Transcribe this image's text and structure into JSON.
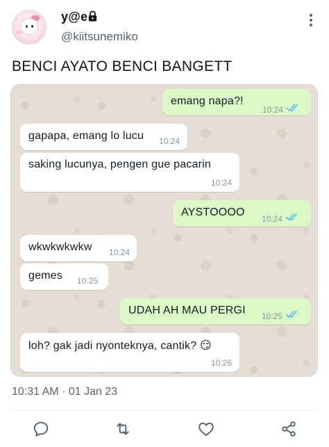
{
  "author": {
    "display_name": "y@e",
    "handle": "@kiitsunemiko",
    "avatar_icon": "avatar-hello-kitty",
    "protected_icon": "lock-icon"
  },
  "tweet": {
    "text": "BENCI AYATO BENCI BANGETT",
    "timestamp": "10:31 AM · 01 Jan 23"
  },
  "chat": {
    "messages": [
      {
        "dir": "out",
        "text": "emang napa?!",
        "time": "10:24",
        "read": true
      },
      {
        "dir": "in",
        "text": "gapapa, emang lo lucu",
        "time": "10:24"
      },
      {
        "dir": "in",
        "text": "saking lucunya, pengen gue pacarin",
        "time": "10:24"
      },
      {
        "dir": "out",
        "text": "AYSTOOOO",
        "time": "10:24",
        "read": true
      },
      {
        "dir": "in",
        "text": "wkwkwkwkw",
        "time": "10:24"
      },
      {
        "dir": "in",
        "text": "gemes",
        "time": "10:25"
      },
      {
        "dir": "out",
        "text": "UDAH AH MAU PERGI",
        "time": "10:25",
        "read": true
      },
      {
        "dir": "in",
        "text": "loh? gak jadi nyonteknya, cantik? 😏",
        "time": "10:26"
      }
    ],
    "colors": {
      "incoming": "#ffffff",
      "outgoing": "#dcf8c6",
      "read_ticks": "#53bdeb",
      "wallpaper": "#e6ded4"
    }
  },
  "actions": {
    "icons": [
      "reply-icon",
      "retweet-icon",
      "like-icon",
      "share-icon"
    ],
    "color": "#536471"
  }
}
